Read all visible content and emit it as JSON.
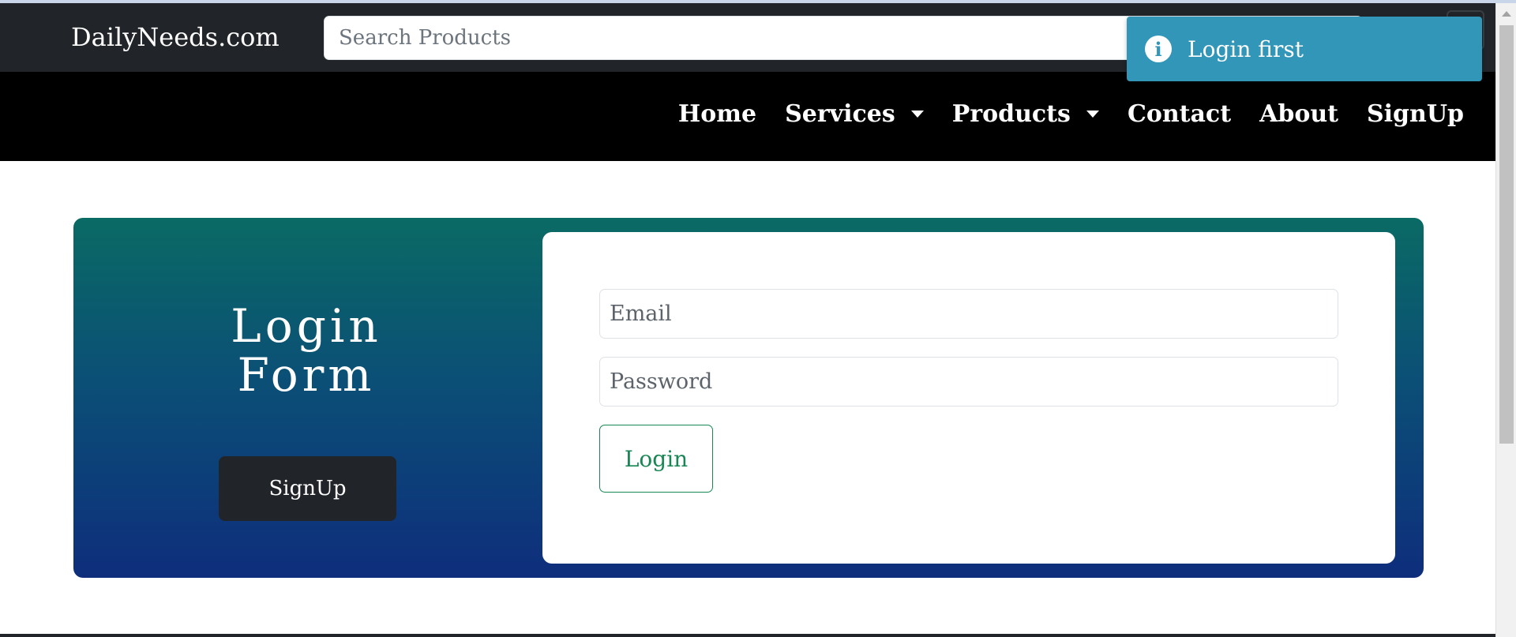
{
  "header": {
    "brand": "DailyNeeds.com",
    "search_placeholder": "Search Products"
  },
  "nav": {
    "items": [
      {
        "label": "Home",
        "has_dropdown": false
      },
      {
        "label": "Services",
        "has_dropdown": true
      },
      {
        "label": "Products",
        "has_dropdown": true
      },
      {
        "label": "Contact",
        "has_dropdown": false
      },
      {
        "label": "About",
        "has_dropdown": false
      },
      {
        "label": "SignUp",
        "has_dropdown": false
      }
    ]
  },
  "toast": {
    "icon": "info-icon",
    "icon_glyph": "i",
    "message": "Login first",
    "color": "#3196b8"
  },
  "login": {
    "title_line1": "Login",
    "title_line2": "Form",
    "signup_label": "SignUp",
    "email_placeholder": "Email",
    "password_placeholder": "Password",
    "login_label": "Login"
  },
  "colors": {
    "topbar": "#212529",
    "navbar": "#000000",
    "gradient_top": "#0a6a64",
    "gradient_bottom": "#0e2e7c",
    "login_button": "#198754"
  }
}
